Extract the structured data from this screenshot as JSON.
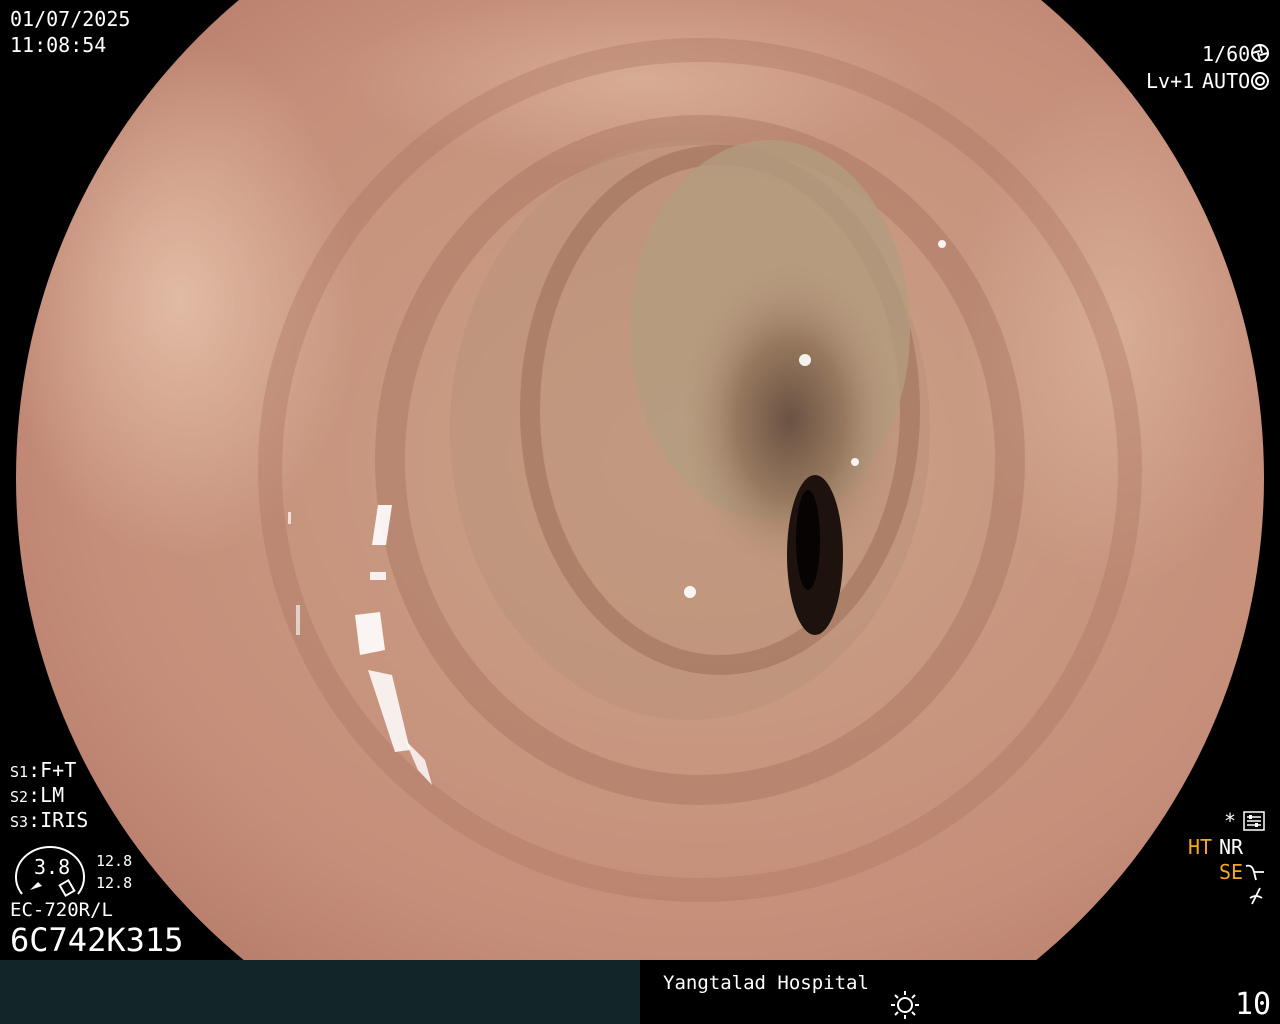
{
  "osd": {
    "date": "01/07/2025",
    "time": "11:08:54",
    "shutter": "1/60",
    "level": "Lv+1",
    "iris_mode": "AUTO",
    "settings": [
      {
        "key": "S1",
        "value": "F+T"
      },
      {
        "key": "S2",
        "value": "LM"
      },
      {
        "key": "S3",
        "value": "IRIS"
      }
    ],
    "gauge_value": "3.8",
    "gauge_side_top": "12.8",
    "gauge_side_bottom": "12.8",
    "scope_model": "EC-720R/L",
    "scope_serial": "6C742K315",
    "asterisk": "*",
    "ht_label": "HT",
    "nr_label": "NR",
    "se_label": "SE",
    "hospital": "Yangtalad Hospital",
    "image_count": "10",
    "colors": {
      "amber": "#f5a623",
      "bar": "#12262a"
    },
    "icons": [
      "shutter-icon",
      "iris-icon",
      "settings-panel-icon",
      "structure-enhance-icon",
      "edge-icon",
      "light-icon",
      "gauge-icon"
    ]
  }
}
